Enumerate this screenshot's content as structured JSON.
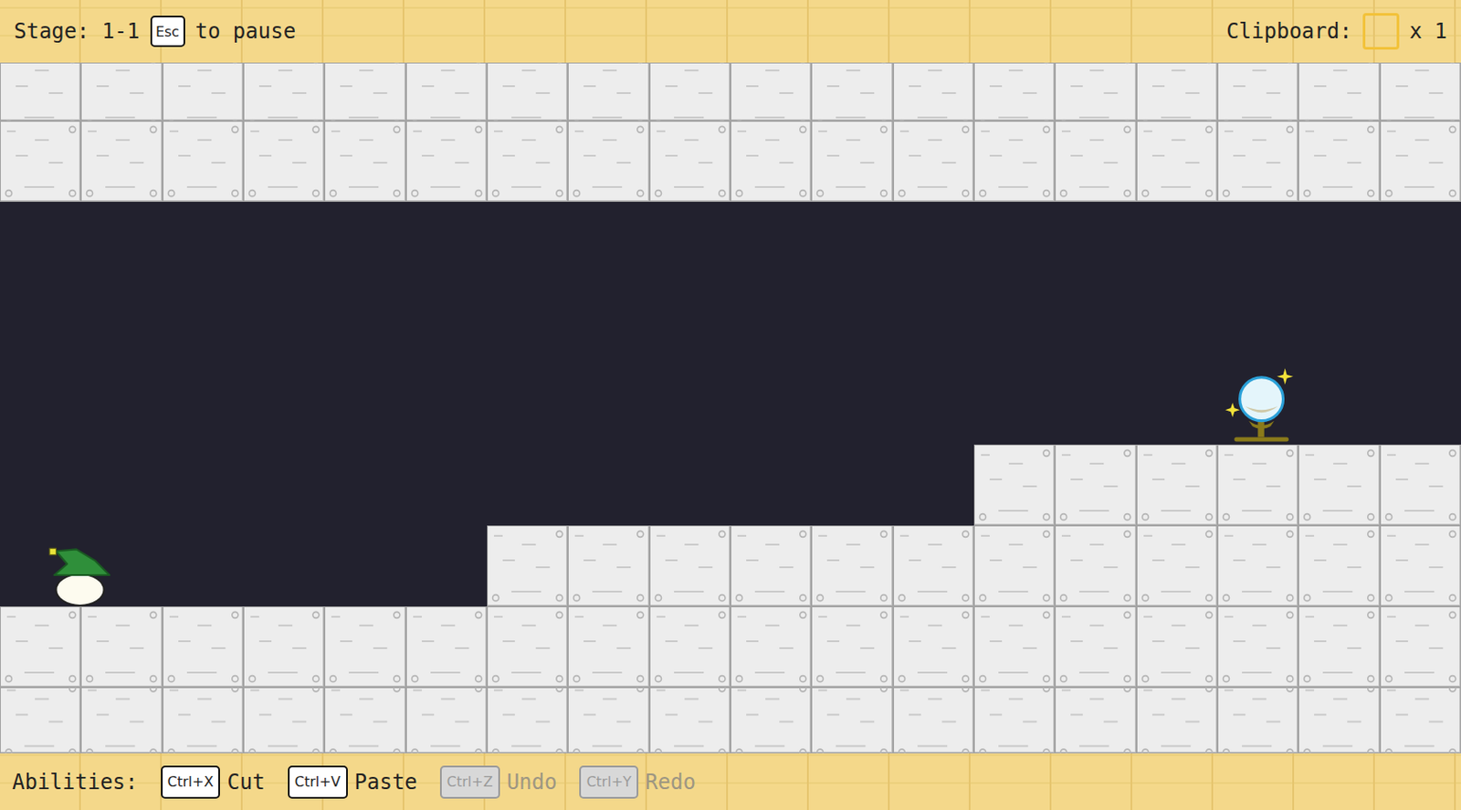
{
  "hud": {
    "stage": "Stage: 1-1",
    "pause_key": "Esc",
    "pause_text": "to pause",
    "clipboard_label": "Clipboard:",
    "clipboard_count": "x 1",
    "clipboard_empty": true
  },
  "abilities": {
    "label": "Abilities:",
    "items": [
      {
        "key": "Ctrl+X",
        "label": "Cut",
        "disabled": false
      },
      {
        "key": "Ctrl+V",
        "label": "Paste",
        "disabled": false
      },
      {
        "key": "Ctrl+Z",
        "label": "Undo",
        "disabled": true
      },
      {
        "key": "Ctrl+Y",
        "label": "Redo",
        "disabled": true
      }
    ]
  },
  "level": {
    "tiles": [
      "##################",
      "##################",
      "..................",
      "..................",
      "...............G..",
      "............######",
      "P.....############",
      "##################",
      "##################"
    ]
  }
}
